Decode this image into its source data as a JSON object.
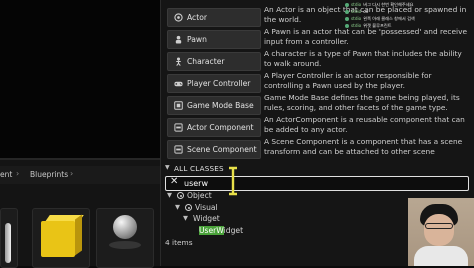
{
  "breadcrumb": {
    "items": [
      "ent",
      "Blueprints"
    ]
  },
  "classes": [
    {
      "label": "Actor",
      "icon": "actor-icon",
      "desc": "An Actor is an object that can be placed or spawned in the world."
    },
    {
      "label": "Pawn",
      "icon": "pawn-icon",
      "desc": "A Pawn is an actor that can be 'possessed' and receive input from a controller."
    },
    {
      "label": "Character",
      "icon": "character-icon",
      "desc": "A character is a type of Pawn that includes the ability to walk around."
    },
    {
      "label": "Player Controller",
      "icon": "gamepad-icon",
      "desc": "A Player Controller is an actor responsible for controlling a Pawn used by the player."
    },
    {
      "label": "Game Mode Base",
      "icon": "game-mode-icon",
      "desc": "Game Mode Base defines the game being played, its rules, scoring, and other facets of the game type."
    },
    {
      "label": "Actor Component",
      "icon": "component-icon",
      "desc": "An ActorComponent is a reusable component that can be added to any actor."
    },
    {
      "label": "Scene Component",
      "icon": "component-icon",
      "desc": "A Scene Component is a component that has a scene transform and can be attached to other scene"
    }
  ],
  "all_classes": {
    "header": "ALL CLASSES",
    "search_value": "userw",
    "tree": {
      "object": "Object",
      "visual": "Visual",
      "widget": "Widget",
      "userwidget_match": "UserW",
      "userwidget_rest": "idget"
    },
    "items_count": "4 items"
  },
  "chat": {
    "lines": [
      {
        "user": "stdio",
        "text": "버그 다시 한번 확인해주세요"
      },
      {
        "user": "stdio",
        "text": "ok"
      },
      {
        "user": "stdio",
        "text": "왼쪽 아래 클래스 창에서 검색"
      },
      {
        "user": "stdio",
        "text": "위젯 블루프린트"
      }
    ]
  },
  "colors": {
    "search_highlight": "#4aa23a",
    "search_border": "#e0e0e0",
    "panel_bg": "#151515",
    "button_bg": "#2d2d2d"
  }
}
